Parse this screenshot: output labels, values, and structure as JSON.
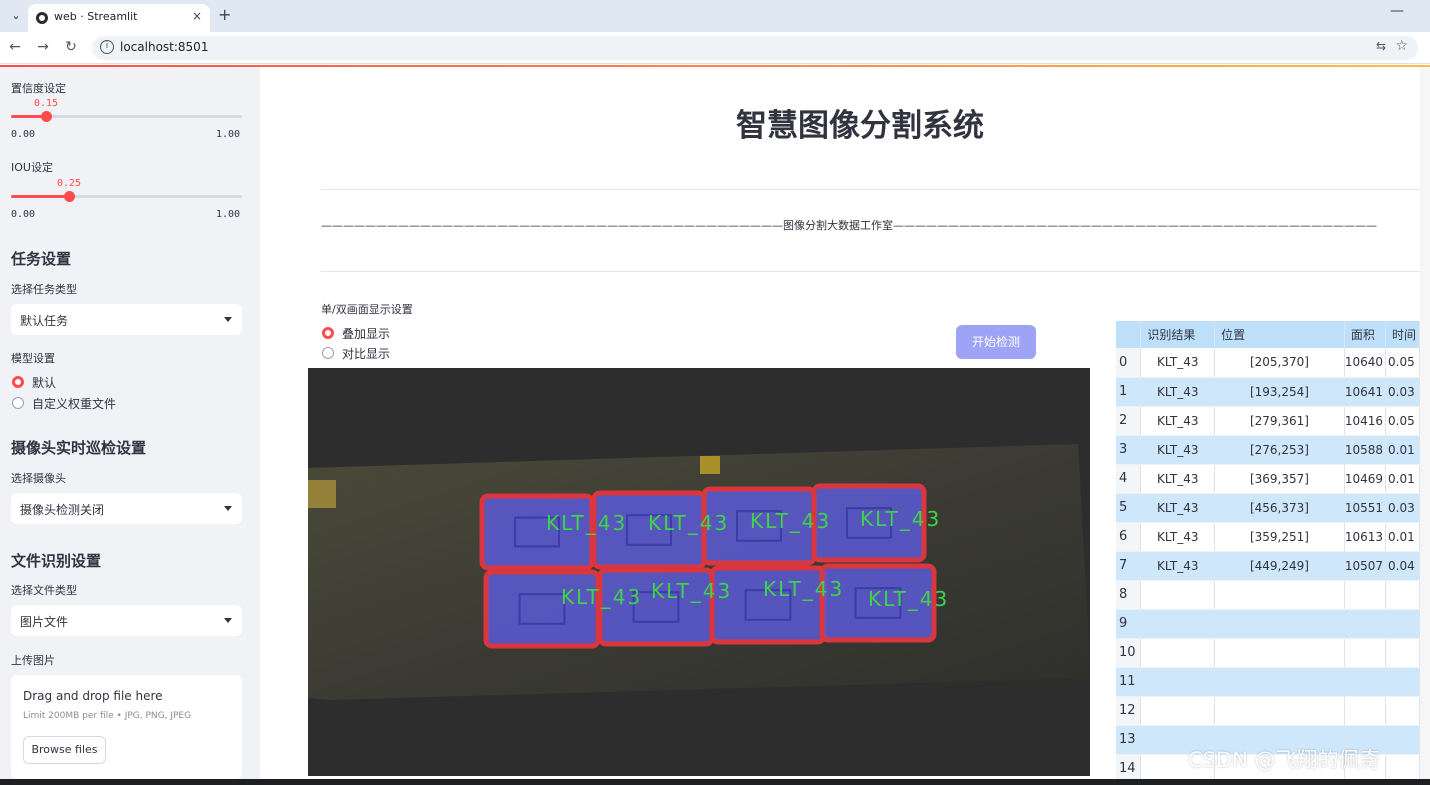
{
  "browser": {
    "tab_title": "web · Streamlit",
    "url": "localhost:8501",
    "new_tab": "+",
    "close": "×",
    "minimize": "—"
  },
  "sidebar": {
    "confidence": {
      "label": "置信度设定",
      "value": "0.15",
      "min": "0.00",
      "max": "1.00",
      "fraction": 0.15
    },
    "iou": {
      "label": "IOU设定",
      "value": "0.25",
      "min": "0.00",
      "max": "1.00",
      "fraction": 0.25
    },
    "task": {
      "heading": "任务设置",
      "select_label": "选择任务类型",
      "selected": "默认任务"
    },
    "model": {
      "label": "模型设置",
      "options": [
        "默认",
        "自定义权重文件"
      ],
      "selected_index": 0
    },
    "camera": {
      "heading": "摄像头实时巡检设置",
      "select_label": "选择摄像头",
      "selected": "摄像头检测关闭"
    },
    "file": {
      "heading": "文件识别设置",
      "select_label": "选择文件类型",
      "selected": "图片文件"
    },
    "upload": {
      "label": "上传图片",
      "title": "Drag and drop file here",
      "hint": "Limit 200MB per file • JPG, PNG, JPEG",
      "button": "Browse files"
    }
  },
  "main": {
    "title": "智慧图像分割系统",
    "divider": "——————————————————————————————————————————图像分割大数据工作室————————————————————————————————————————————",
    "display_mode": {
      "label": "单/双画面显示设置",
      "options": [
        "叠加显示",
        "对比显示"
      ],
      "selected_index": 0
    },
    "start_button": "开始检测",
    "detections_label": "KLT_43",
    "table": {
      "columns": [
        "识别结果",
        "位置",
        "面积",
        "时间"
      ],
      "rows": [
        {
          "idx": "0",
          "result": "KLT_43",
          "position": "[205,370]",
          "area": "10640",
          "time": "0.05"
        },
        {
          "idx": "1",
          "result": "KLT_43",
          "position": "[193,254]",
          "area": "10641",
          "time": "0.03"
        },
        {
          "idx": "2",
          "result": "KLT_43",
          "position": "[279,361]",
          "area": "10416",
          "time": "0.05"
        },
        {
          "idx": "3",
          "result": "KLT_43",
          "position": "[276,253]",
          "area": "10588",
          "time": "0.01"
        },
        {
          "idx": "4",
          "result": "KLT_43",
          "position": "[369,357]",
          "area": "10469",
          "time": "0.01"
        },
        {
          "idx": "5",
          "result": "KLT_43",
          "position": "[456,373]",
          "area": "10551",
          "time": "0.03"
        },
        {
          "idx": "6",
          "result": "KLT_43",
          "position": "[359,251]",
          "area": "10613",
          "time": "0.01"
        },
        {
          "idx": "7",
          "result": "KLT_43",
          "position": "[449,249]",
          "area": "10507",
          "time": "0.04"
        },
        {
          "idx": "8",
          "result": "",
          "position": "",
          "area": "",
          "time": ""
        },
        {
          "idx": "9",
          "result": "",
          "position": "",
          "area": "",
          "time": ""
        },
        {
          "idx": "10",
          "result": "",
          "position": "",
          "area": "",
          "time": ""
        },
        {
          "idx": "11",
          "result": "",
          "position": "",
          "area": "",
          "time": ""
        },
        {
          "idx": "12",
          "result": "",
          "position": "",
          "area": "",
          "time": ""
        },
        {
          "idx": "13",
          "result": "",
          "position": "",
          "area": "",
          "time": ""
        },
        {
          "idx": "14",
          "result": "",
          "position": "",
          "area": "",
          "time": ""
        }
      ]
    }
  },
  "watermark": "CSDN @飞翔的佩奇",
  "colors": {
    "accent": "#ff4b4b",
    "button": "#9ea3f6",
    "table_header": "#bfe0fb",
    "table_alt": "#cfe7fb",
    "mask": "#5a5ad6",
    "box": "#d9363e",
    "label": "#3fd24a"
  }
}
